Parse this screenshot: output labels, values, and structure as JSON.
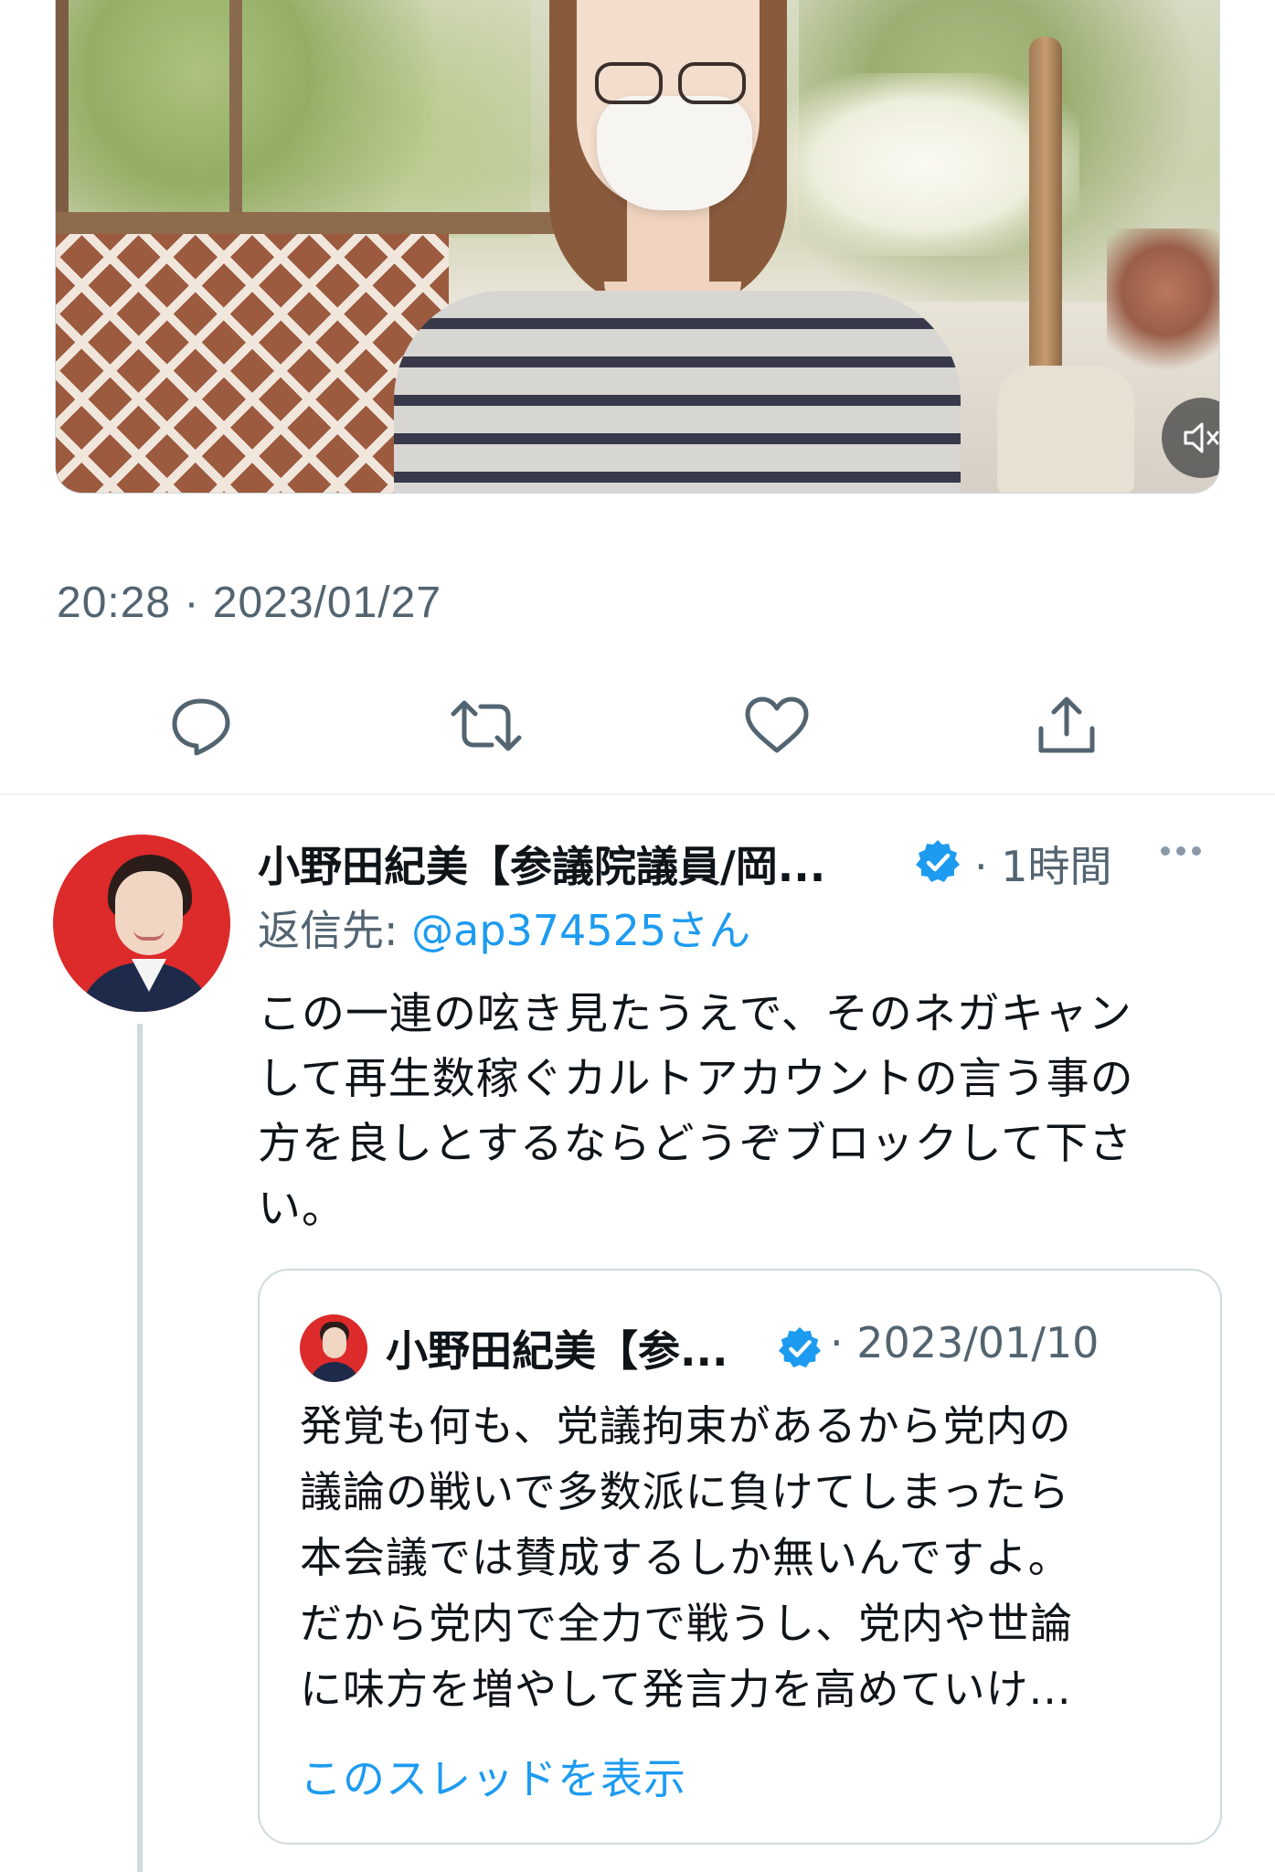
{
  "media": {
    "mute_icon": "volume-muted-icon"
  },
  "tweet": {
    "timestamp": "20:28 · 2023/01/27",
    "actions": [
      {
        "name": "reply",
        "icon": "reply-icon"
      },
      {
        "name": "retweet",
        "icon": "retweet-icon"
      },
      {
        "name": "like",
        "icon": "heart-icon"
      },
      {
        "name": "share",
        "icon": "share-icon"
      }
    ]
  },
  "reply": {
    "author_name": "小野田紀美【参議院議員/岡...",
    "verified_icon": "verified-badge-icon",
    "time_ago": "· 1時間",
    "more_icon": "more-icon",
    "reply_to_label": "返信先:",
    "reply_to_handle": "@ap374525",
    "reply_to_suffix": "さん",
    "text_lines": [
      "この一連の呟き見たうえで、そのネガキャン",
      "して再生数稼ぐカルトアカウントの言う事の",
      "方を良しとするならどうぞブロックして下さ",
      "い。"
    ]
  },
  "quote": {
    "author_name": "小野田紀美【参...",
    "date": "· 2023/01/10",
    "text_lines": [
      "発覚も何も、党議拘束があるから党内の",
      "議論の戦いで多数派に負けてしまったら",
      "本会議では賛成するしか無いんですよ。",
      "だから党内で全力で戦うし、党内や世論",
      "に味方を増やして発言力を高めていけ..."
    ],
    "show_thread": "このスレッドを表示"
  },
  "colors": {
    "link_blue": "#1d9bf0",
    "secondary_text": "#536471",
    "primary_text": "#0f1419",
    "border": "#cfd9de"
  }
}
